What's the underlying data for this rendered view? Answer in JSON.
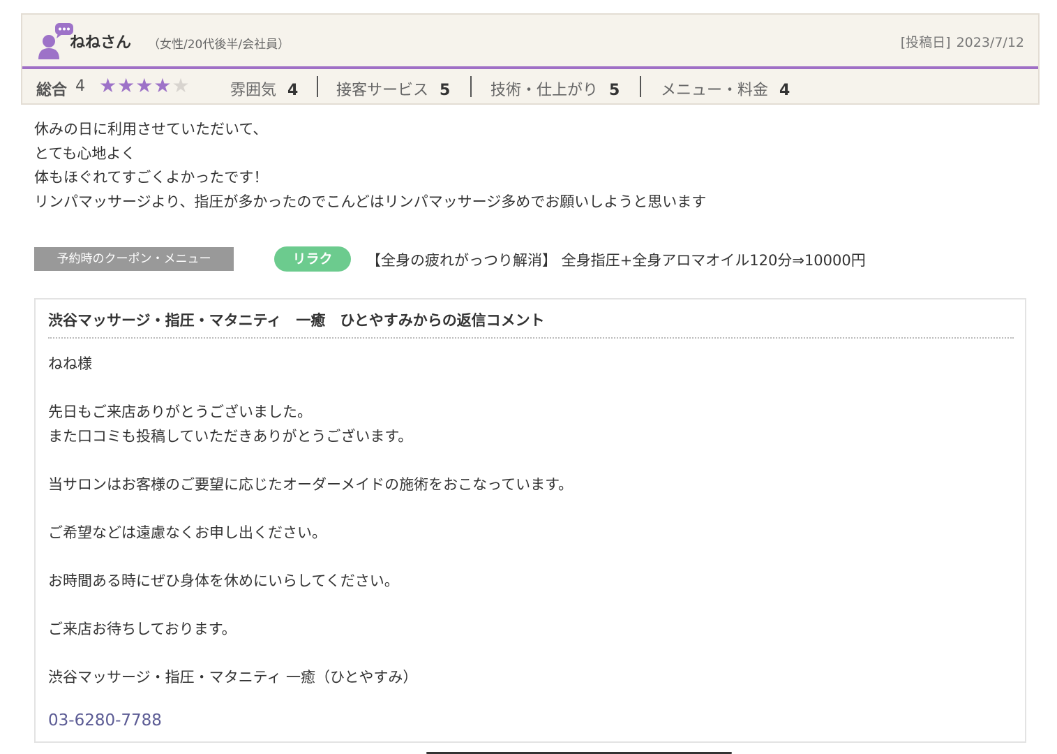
{
  "review": {
    "reviewer_name": "ねねさん",
    "reviewer_attributes": "（女性/20代後半/会社員）",
    "posted_label": "[投稿日]",
    "posted_date": "2023/7/12",
    "overall_label": "総合",
    "overall_score": "4",
    "overall_stars": 4,
    "categories": [
      {
        "label": "雰囲気",
        "score": "4"
      },
      {
        "label": "接客サービス",
        "score": "5"
      },
      {
        "label": "技術・仕上がり",
        "score": "5"
      },
      {
        "label": "メニュー・料金",
        "score": "4"
      }
    ],
    "body_lines": [
      "休みの日に利用させていただいて、",
      "とても心地よく",
      "体もほぐれてすごくよかったです！",
      "リンパマッサージより、指圧が多かったのでこんどはリンパマッサージ多めでお願いしようと思います"
    ]
  },
  "coupon": {
    "tag_label": "予約時のクーポン・メニュー",
    "genre_badge": "リラク",
    "text": "【全身の疲れがっつり解消】 全身指圧+全身アロマオイル120分⇒10000円"
  },
  "reply": {
    "title": "渋谷マッサージ・指圧・マタニティ　一癒　ひとやすみからの返信コメント",
    "body_lines": [
      "ねね様",
      "",
      "先日もご来店ありがとうございました。",
      "また口コミも投稿していただきありがとうございます。",
      "",
      "当サロンはお客様のご要望に応じたオーダーメイドの施術をおこなっています。",
      "",
      "ご希望などは遠慮なくお申し出ください。",
      "",
      "お時間ある時にぜひ身体を休めにいらしてください。",
      "",
      "ご来店お待ちしております。",
      "",
      "渋谷マッサージ・指圧・マタニティ 一癒（ひとやすみ）"
    ],
    "phone": "03-6280-7788"
  },
  "colors": {
    "accent_purple": "#9f6fc6",
    "star_filled": "#9d72c8",
    "genre_green": "#6ccb8e",
    "phone_link": "#5b5b94"
  },
  "icons": {
    "reviewer": "user-with-speech-bubble-icon",
    "star": "star-icon"
  }
}
